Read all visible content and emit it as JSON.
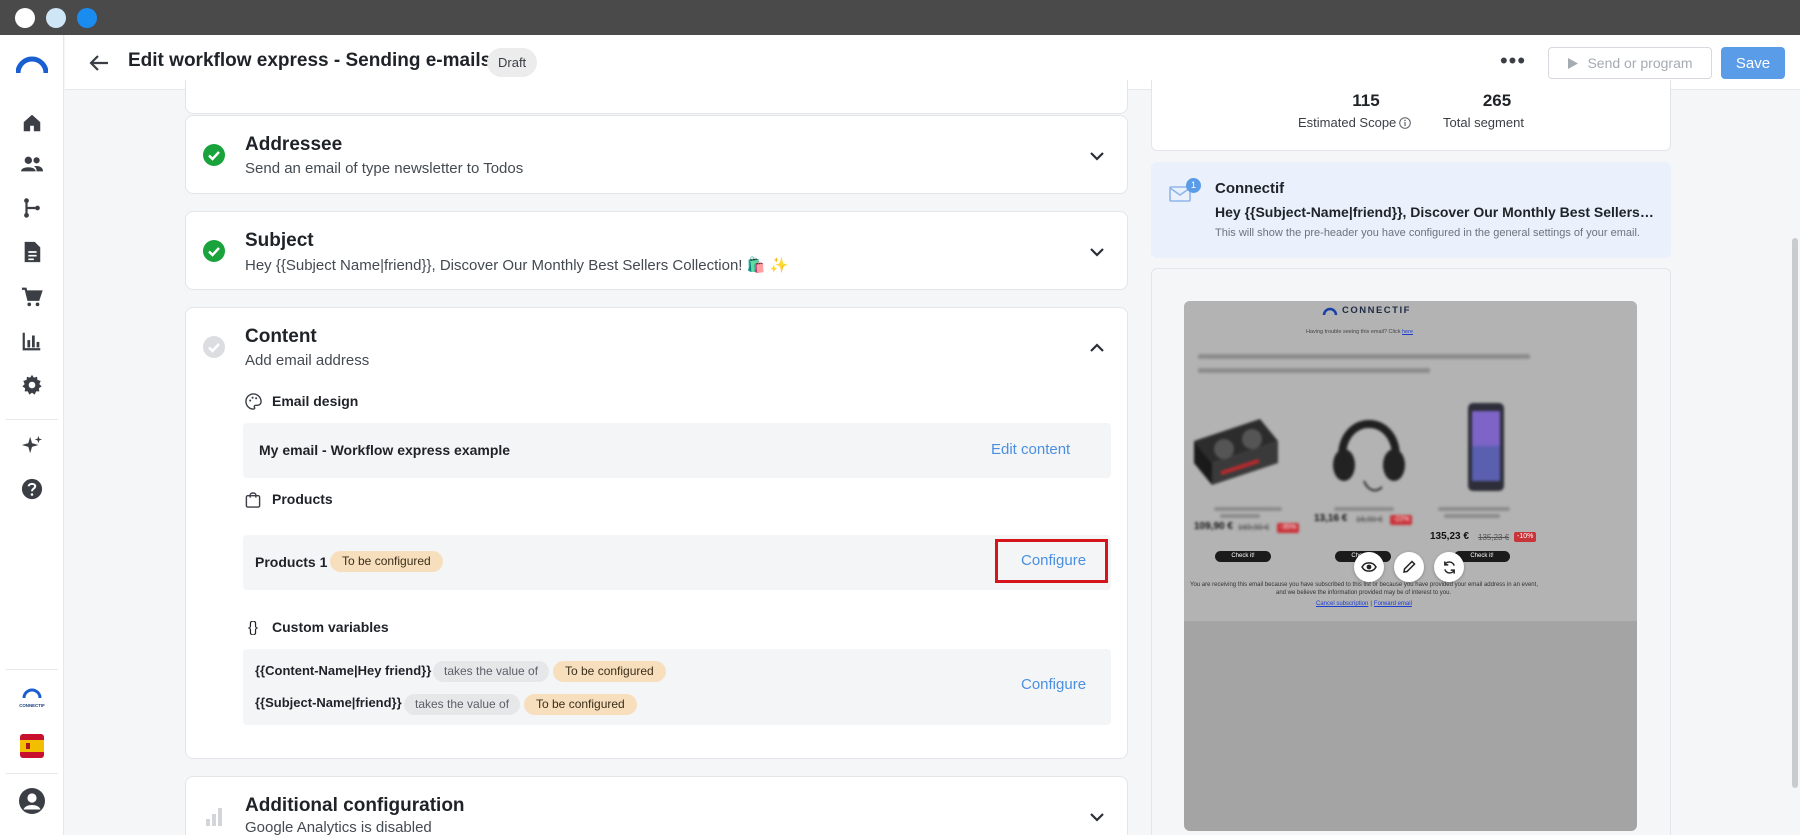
{
  "colors": {
    "accent": "#5b9ce9",
    "link": "#4a8fe0",
    "success": "#1aa33c",
    "pending_pill": "#f7dfbe",
    "highlight": "#d6141c",
    "os_dots": [
      "#ffffff",
      "#cfe6f7",
      "#1a8cf0"
    ]
  },
  "rail": {
    "items": [
      {
        "name": "home",
        "icon": "home-icon"
      },
      {
        "name": "contacts",
        "icon": "people-icon"
      },
      {
        "name": "workflows",
        "icon": "workflow-icon"
      },
      {
        "name": "content",
        "icon": "document-icon"
      },
      {
        "name": "store",
        "icon": "cart-icon"
      },
      {
        "name": "analytics",
        "icon": "bar-chart-icon"
      },
      {
        "name": "settings",
        "icon": "gear-icon"
      },
      {
        "name": "ai",
        "icon": "sparkle-icon"
      },
      {
        "name": "help",
        "icon": "help-icon"
      }
    ],
    "org_logo_text": "CONNECTIF",
    "language_flag": "es",
    "user_icon": "user-icon"
  },
  "header": {
    "title": "Edit workflow express - Sending e-mails",
    "status_badge": "Draft",
    "more_label": "•••",
    "send_label": "Send or program",
    "save_label": "Save"
  },
  "steps": {
    "addressee": {
      "title": "Addressee",
      "subtitle": "Send an email of type newsletter to Todos",
      "status": "complete"
    },
    "subject": {
      "title": "Subject",
      "subtitle": "Hey {{Subject Name|friend}}, Discover Our Monthly Best Sellers Collection! 🛍️ ✨",
      "status": "complete"
    },
    "content": {
      "title": "Content",
      "subtitle": "Add email address",
      "status": "pending",
      "email_design": {
        "label": "Email design",
        "email_name": "My email - Workflow express example",
        "action": "Edit content"
      },
      "products": {
        "label": "Products",
        "item_name": "Products 1",
        "item_status": "To be configured",
        "action": "Configure"
      },
      "custom_variables": {
        "label": "Custom variables",
        "icon_text": "{}",
        "rows": [
          {
            "name": "{{Content-Name|Hey friend}}",
            "relation": "takes the value of",
            "status": "To be configured"
          },
          {
            "name": "{{Subject-Name|friend}}",
            "relation": "takes the value of",
            "status": "To be configured"
          }
        ],
        "action": "Configure"
      }
    },
    "additional": {
      "title": "Additional configuration",
      "subtitle": "Google Analytics is disabled",
      "status": "pending"
    }
  },
  "scope": {
    "estimated_value": "115",
    "estimated_label": "Estimated Scope",
    "total_value": "265",
    "total_label": "Total segment"
  },
  "sender": {
    "badge_count": "1",
    "name": "Connectif",
    "subject": "Hey {{Subject-Name|friend}}, Discover Our Monthly Best Sellers Collection! 🛍️ ✨",
    "preheader": "This will show the pre-header you have configured in the general settings of your email."
  },
  "preview": {
    "brand": "CONNECTIF",
    "trouble_text": "Having trouble seeing this email? Click",
    "trouble_link": "here",
    "products": [
      {
        "price": "109,90 €",
        "old_price": "169,90 €",
        "discount": "-35%",
        "button": "Check it!"
      },
      {
        "price": "13,16 €",
        "old_price": "16,90 €",
        "discount": "-22%",
        "button": "Check it!"
      },
      {
        "price": "135,23 €",
        "old_price": "135,23 €",
        "discount": "-10%",
        "button": "Check it!"
      }
    ],
    "footer_line1": "You are receiving this email because you have subscribed to this list or because you have provided your email address in an event,",
    "footer_line2": "and we believe the information provided may be of interest to you.",
    "cancel_link": "Cancel subscription",
    "separator": "|",
    "forward_link": "Forward email",
    "tools": [
      "eye-icon",
      "pencil-icon",
      "refresh-icon"
    ]
  }
}
